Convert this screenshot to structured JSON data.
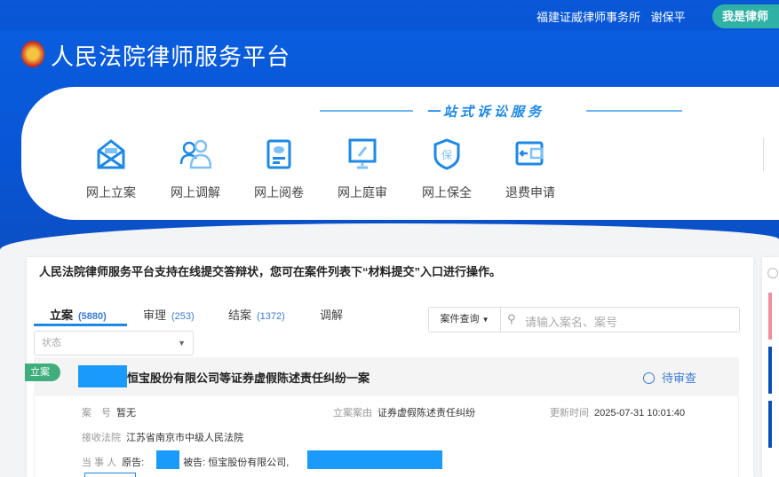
{
  "header": {
    "firm": "福建证威律师事务所",
    "user": "谢保平",
    "lawyer_button": "我是律师",
    "title": "人民法院律师服务平台"
  },
  "services": {
    "slogan": "一站式诉讼服务",
    "items": [
      {
        "label": "网上立案",
        "icon": "envelope-icon"
      },
      {
        "label": "网上调解",
        "icon": "people-icon"
      },
      {
        "label": "网上阅卷",
        "icon": "document-eye-icon"
      },
      {
        "label": "网上庭审",
        "icon": "gavel-screen-icon"
      },
      {
        "label": "网上保全",
        "icon": "shield-bao-icon"
      },
      {
        "label": "退费申请",
        "icon": "wallet-refund-icon"
      }
    ]
  },
  "notice": "人民法院律师服务平台支持在线提交答辩状，您可在案件列表下“材料提交”入口进行操作。",
  "tabs": [
    {
      "label": "立案",
      "count": "(5880)"
    },
    {
      "label": "审理",
      "count": "(253)"
    },
    {
      "label": "结案",
      "count": "(1372)"
    },
    {
      "label": "调解",
      "count": ""
    }
  ],
  "filter": {
    "status_placeholder": "状态",
    "query_type": "案件查询",
    "search_placeholder": "请输入案名、案号"
  },
  "case": {
    "tag": "立案",
    "title": "恒宝股份有限公司等证券虚假陈述责任纠纷一案",
    "status": "待审查",
    "case_no_label": "案　号",
    "case_no": "暂无",
    "cause_label": "立案案由",
    "cause": "证券虚假陈述责任纠纷",
    "updated_label": "更新时间",
    "updated": "2025-07-31 10:01:40",
    "court_label": "接收法院",
    "court": "江苏省南京市中级人民法院",
    "party_label": "当 事 人",
    "plaintiff_label": "原告:",
    "defendant_label": "被告:",
    "defendant": "恒宝股份有限公司,"
  },
  "colors": {
    "brand": "#0856d6",
    "accent": "#1e88e5",
    "tag": "#3fae7c"
  }
}
